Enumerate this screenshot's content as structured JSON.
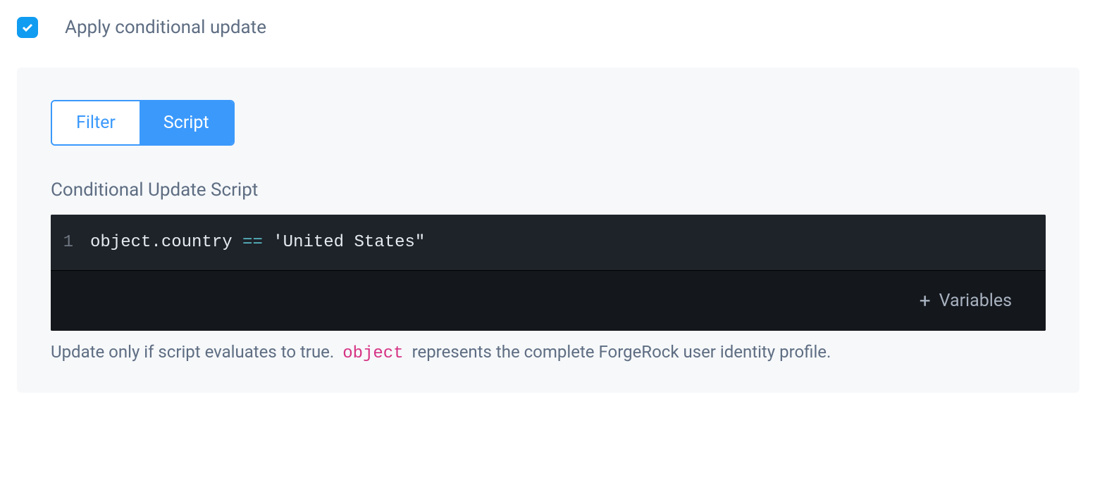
{
  "checkbox": {
    "checked": true,
    "label": "Apply conditional update"
  },
  "tabs": {
    "filter": "Filter",
    "script": "Script",
    "active": "script"
  },
  "section_label": "Conditional Update Script",
  "editor": {
    "line_number": "1",
    "code_prefix": "object.country ",
    "code_op": "==",
    "code_suffix": " 'United States\""
  },
  "variables_button": "Variables",
  "help": {
    "part1": "Update only if script evaluates to true. ",
    "code": "object",
    "part2": " represents the complete ForgeRock user identity profile."
  }
}
